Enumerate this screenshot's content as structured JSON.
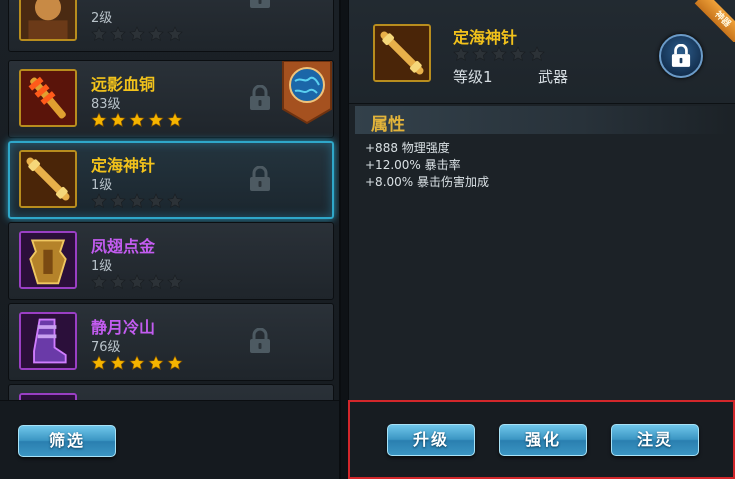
{
  "items": [
    {
      "name": "",
      "level": "2级",
      "stars": 0,
      "quality": "gold",
      "locked": true
    },
    {
      "name": "远影血铜",
      "level": "83级",
      "stars": 5,
      "quality": "gold",
      "locked": true
    },
    {
      "name": "定海神针",
      "level": "1级",
      "stars": 0,
      "quality": "gold",
      "locked": true
    },
    {
      "name": "凤翅点金",
      "level": "1级",
      "stars": 0,
      "quality": "purple",
      "locked": false
    },
    {
      "name": "静月冷山",
      "level": "76级",
      "stars": 5,
      "quality": "purple",
      "locked": true
    }
  ],
  "filter_label": "筛选",
  "detail": {
    "name": "定海神针",
    "level": "等级1",
    "type": "武器",
    "stars": 0,
    "ribbon": "神器",
    "attributes_title": "属性",
    "attributes": [
      "+888 物理强度",
      "+12.00% 暴击率",
      "+8.00% 暴击伤害加成"
    ]
  },
  "actions": {
    "upgrade": "升级",
    "enhance": "强化",
    "infuse": "注灵"
  },
  "colors": {
    "gold_text": "#f2c21b",
    "purple_text": "#c35cf0",
    "selection": "#2fa7c9",
    "highlight_box": "#d3272b"
  }
}
